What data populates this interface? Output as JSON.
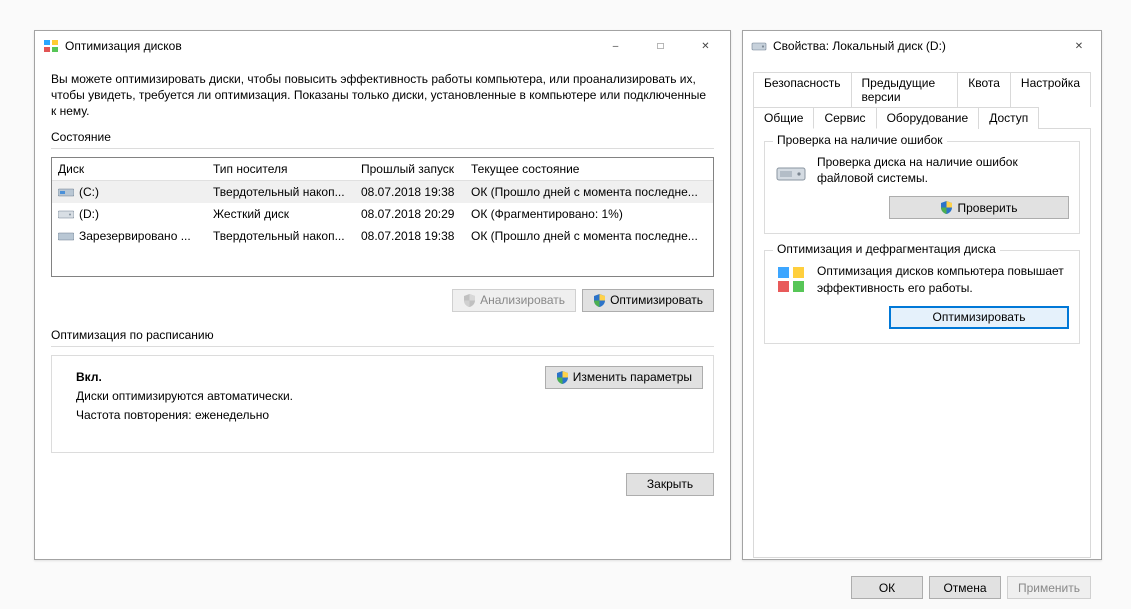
{
  "optimize_window": {
    "title": "Оптимизация дисков",
    "intro": "Вы можете оптимизировать диски, чтобы повысить эффективность работы  компьютера, или проанализировать их, чтобы увидеть, требуется ли оптимизация. Показаны только диски, установленные в компьютере или подключенные к нему.",
    "state_label": "Состояние",
    "columns": {
      "disk": "Диск",
      "media": "Тип носителя",
      "last": "Прошлый запуск",
      "status": "Текущее состояние"
    },
    "rows": [
      {
        "name": "(C:)",
        "media": "Твердотельный накоп...",
        "last": "08.07.2018 19:38",
        "status": "ОК (Прошло дней с момента последне..."
      },
      {
        "name": "(D:)",
        "media": "Жесткий диск",
        "last": "08.07.2018 20:29",
        "status": "ОК (Фрагментировано: 1%)"
      },
      {
        "name": "Зарезервировано ...",
        "media": "Твердотельный накоп...",
        "last": "08.07.2018 19:38",
        "status": "ОК (Прошло дней с момента последне..."
      }
    ],
    "analyze_btn": "Анализировать",
    "optimize_btn": "Оптимизировать",
    "schedule_label": "Оптимизация по расписанию",
    "schedule": {
      "status": "Вкл.",
      "line1": "Диски оптимизируются автоматически.",
      "line2": "Частота повторения: еженедельно"
    },
    "change_btn": "Изменить параметры",
    "close_btn": "Закрыть"
  },
  "props_window": {
    "title": "Свойства: Локальный диск (D:)",
    "tabs_row1": [
      "Безопасность",
      "Предыдущие версии",
      "Квота",
      "Настройка"
    ],
    "tabs_row2": [
      "Общие",
      "Сервис",
      "Оборудование",
      "Доступ"
    ],
    "active_tab_index": 1,
    "check": {
      "group": "Проверка на наличие ошибок",
      "text": "Проверка диска на наличие ошибок файловой системы.",
      "btn": "Проверить"
    },
    "defrag": {
      "group": "Оптимизация и дефрагментация диска",
      "text": "Оптимизация дисков компьютера повышает эффективность его работы.",
      "btn": "Оптимизировать"
    },
    "ok": "ОК",
    "cancel": "Отмена",
    "apply": "Применить"
  }
}
